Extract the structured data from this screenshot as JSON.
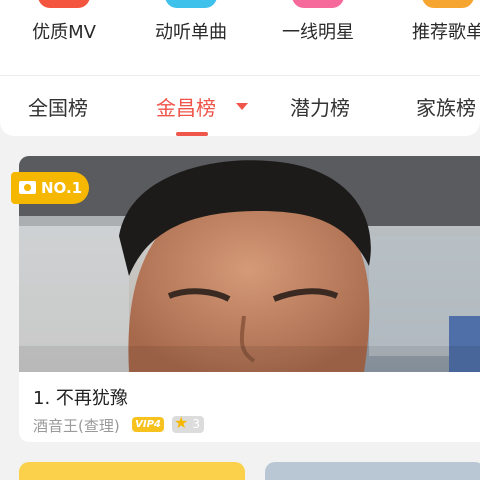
{
  "categories": [
    {
      "label": "优质MV",
      "color": "#f4553f"
    },
    {
      "label": "动听单曲",
      "color": "#3ec1ea"
    },
    {
      "label": "一线明星",
      "color": "#f56a9a"
    },
    {
      "label": "推荐歌单",
      "color": "#f6a531"
    }
  ],
  "tabs": {
    "items": [
      "全国榜",
      "金昌榜",
      "潜力榜",
      "家族榜"
    ],
    "active_index": 1,
    "accent_color": "#f0554a"
  },
  "ranking": {
    "badge": "NO.1",
    "title": "1. 不再犹豫",
    "singer": "酒音王(查理)",
    "vip": "VIP4",
    "level": "3"
  }
}
